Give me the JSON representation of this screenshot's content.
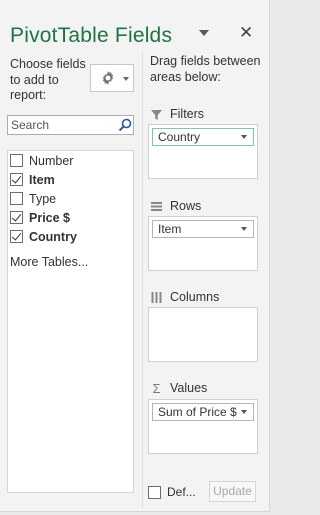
{
  "pane": {
    "title": "PivotTable Fields",
    "close_glyph": "✕",
    "choose_fields_label": "Choose fields to add to report:",
    "drag_fields_label": "Drag fields between areas below:"
  },
  "search": {
    "placeholder": "Search",
    "value": ""
  },
  "fields": [
    {
      "label": "Number",
      "checked": false,
      "bold": false
    },
    {
      "label": "Item",
      "checked": true,
      "bold": true
    },
    {
      "label": "Type",
      "checked": false,
      "bold": false
    },
    {
      "label": "Price $",
      "checked": true,
      "bold": true
    },
    {
      "label": "Country",
      "checked": true,
      "bold": true
    }
  ],
  "more_tables_label": "More Tables...",
  "areas": {
    "filters": {
      "label": "Filters",
      "items": [
        "Country"
      ]
    },
    "rows": {
      "label": "Rows",
      "items": [
        "Item"
      ]
    },
    "columns": {
      "label": "Columns",
      "items": []
    },
    "values": {
      "label": "Values",
      "items": [
        "Sum of Price $"
      ]
    }
  },
  "footer": {
    "defer_label": "Def...",
    "defer_checked": false,
    "update_label": "Update"
  },
  "colors": {
    "title": "#217346",
    "pane_bg": "#f3f3f3",
    "highlight_border": "#7fc8a1"
  }
}
